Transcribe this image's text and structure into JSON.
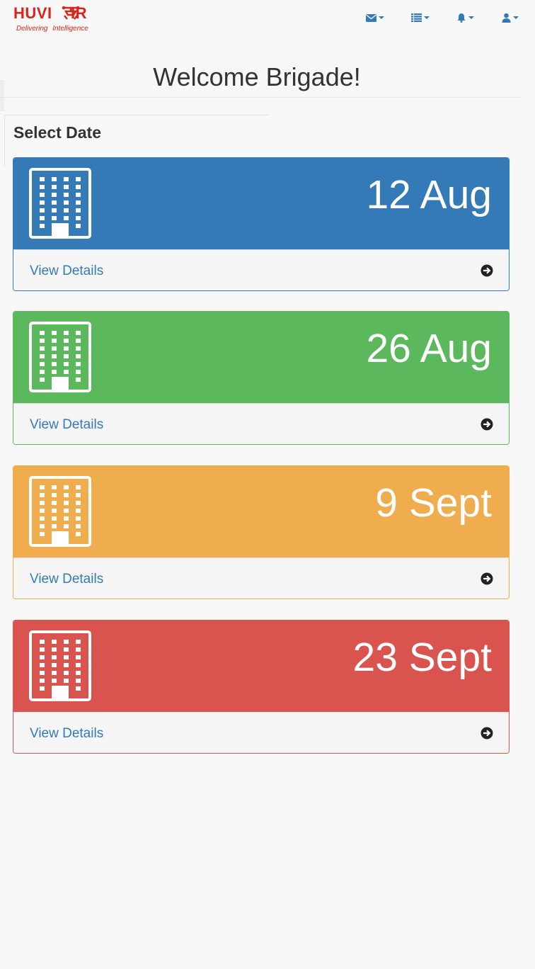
{
  "brand": {
    "name": "HUVI AIR",
    "tagline": "Delivering  Intelligence",
    "color": "#d9241b"
  },
  "navbar": {
    "items": [
      {
        "icon": "envelope-icon"
      },
      {
        "icon": "list-icon"
      },
      {
        "icon": "bell-icon"
      },
      {
        "icon": "user-icon"
      }
    ]
  },
  "page": {
    "welcome": "Welcome Brigade!",
    "section_title": "Select Date"
  },
  "panels": [
    {
      "date": "12 Aug",
      "footer": "View Details",
      "color": "#337ab7"
    },
    {
      "date": "26 Aug",
      "footer": "View Details",
      "color": "#5cb85c"
    },
    {
      "date": "9 Sept",
      "footer": "View Details",
      "color": "#f0ad4e"
    },
    {
      "date": "23 Sept",
      "footer": "View Details",
      "color": "#d9534f"
    }
  ]
}
